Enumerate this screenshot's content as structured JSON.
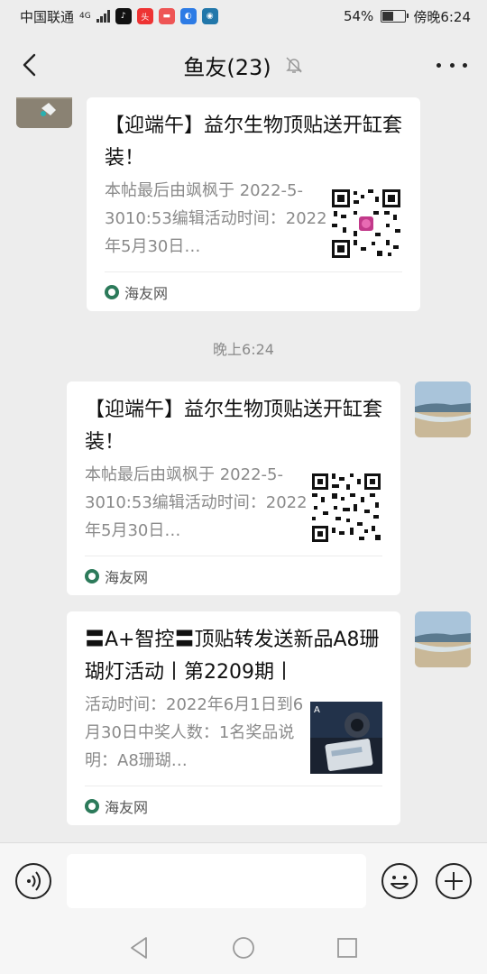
{
  "status_bar": {
    "carrier": "中国联通",
    "network": "4G",
    "battery": "54%",
    "battery_level": 0.54,
    "time": "傍晚6:24"
  },
  "header": {
    "title": "鱼友(23)"
  },
  "messages": [
    {
      "title": "【迎端午】益尔生物顶贴送开缸套装！",
      "description": "本帖最后由飒枫于 2022-5-3010:53编辑活动时间：2022年5月30日…",
      "source": "海友网"
    },
    {
      "timestamp": "晚上6:24"
    },
    {
      "title": "【迎端午】益尔生物顶贴送开缸套装！",
      "description": "本帖最后由飒枫于 2022-5-3010:53编辑活动时间：2022年5月30日…",
      "source": "海友网"
    },
    {
      "title": "〓A+智控〓顶贴转发送新品A8珊 瑚灯活动丨第2209期丨",
      "description": "活动时间：2022年6月1日到6月30日中奖人数：1名奖品说明：A8珊瑚…",
      "source": "海友网",
      "thumb_text": "A"
    }
  ],
  "input_bar": {
    "placeholder": ""
  }
}
